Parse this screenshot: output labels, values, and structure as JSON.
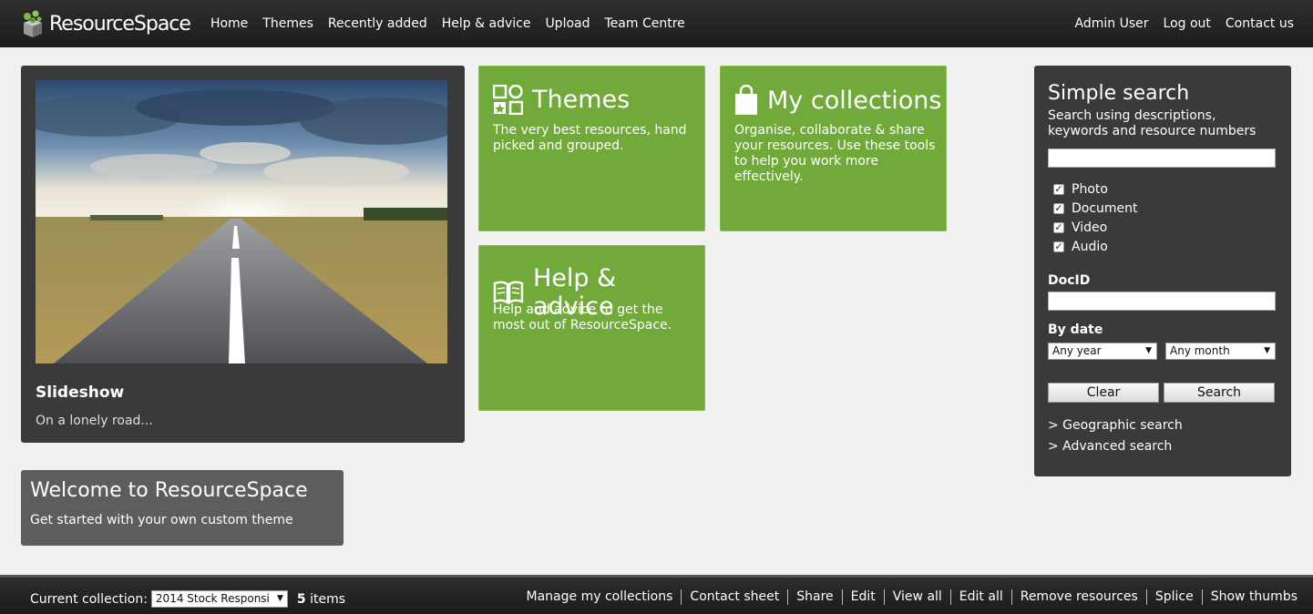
{
  "header": {
    "logo": "ResourceSpace",
    "nav": [
      "Home",
      "Themes",
      "Recently added",
      "Help & advice",
      "Upload",
      "Team Centre"
    ],
    "user": "Admin User",
    "logout": "Log out",
    "contact": "Contact us"
  },
  "slideshow": {
    "title": "Slideshow",
    "caption": "On a lonely road..."
  },
  "tiles": {
    "themes": {
      "title": "Themes",
      "desc": "The very best resources, hand picked and grouped."
    },
    "collections": {
      "title": "My collections",
      "desc": "Organise, collaborate & share your resources. Use these tools to help you work more effectively."
    },
    "help": {
      "title": "Help & advice",
      "desc": "Help and advice to get the most out of ResourceSpace."
    }
  },
  "welcome": {
    "title": "Welcome to ResourceSpace",
    "subtitle": "Get started with your own custom theme"
  },
  "search": {
    "title": "Simple search",
    "desc": "Search using descriptions, keywords and resource numbers",
    "types": [
      "Photo",
      "Document",
      "Video",
      "Audio"
    ],
    "docid_label": "DocID",
    "date_label": "By date",
    "year": "Any year",
    "month": "Any month",
    "clear": "Clear",
    "submit": "Search",
    "geo_link": "> Geographic search",
    "adv_link": "> Advanced search"
  },
  "footer": {
    "current_label": "Current collection:",
    "current_value": "2014 Stock Responsi",
    "item_count": "5",
    "items_label": "items",
    "links": [
      "Manage my collections",
      "Contact sheet",
      "Share",
      "Edit",
      "View all",
      "Edit all",
      "Remove resources",
      "Splice",
      "Show thumbs"
    ]
  },
  "colors": {
    "accent": "#71a93b",
    "panel": "#3a3a3a",
    "background": "#f1f1f1"
  }
}
